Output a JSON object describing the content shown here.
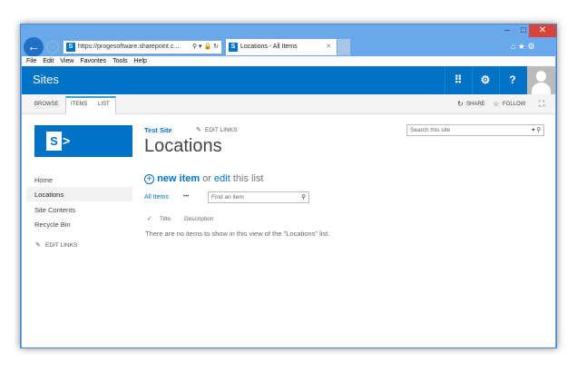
{
  "browser": {
    "url": "https://progesoftware.sharepoint.c...",
    "tab_title": "Locations - All Items",
    "menu": [
      "File",
      "Edit",
      "View",
      "Favorites",
      "Tools",
      "Help"
    ]
  },
  "suite": {
    "title": "Sites",
    "app_launcher_icon": "grid",
    "settings_icon": "gear",
    "help_label": "?"
  },
  "ribbon": {
    "tabs": [
      "BROWSE",
      "ITEMS",
      "LIST"
    ],
    "share": "SHARE",
    "follow": "FOLLOW"
  },
  "site": {
    "breadcrumb": "Test Site",
    "edit_links": "EDIT LINKS",
    "title": "Locations",
    "search_placeholder": "Search this site"
  },
  "leftnav": {
    "items": [
      "Home",
      "Locations",
      "Site Contents",
      "Recycle Bin"
    ],
    "edit_links": "EDIT LINKS"
  },
  "list": {
    "new_item": "new item",
    "or": "or",
    "edit": "edit",
    "this_list": "this list",
    "view": "All Items",
    "more": "•••",
    "find_placeholder": "Find an item",
    "columns": [
      "Title",
      "Description"
    ],
    "empty": "There are no items to show in this view of the \"Locations\" list."
  },
  "colors": {
    "brand": "#0072c6",
    "frame": "#6aa8ec"
  }
}
